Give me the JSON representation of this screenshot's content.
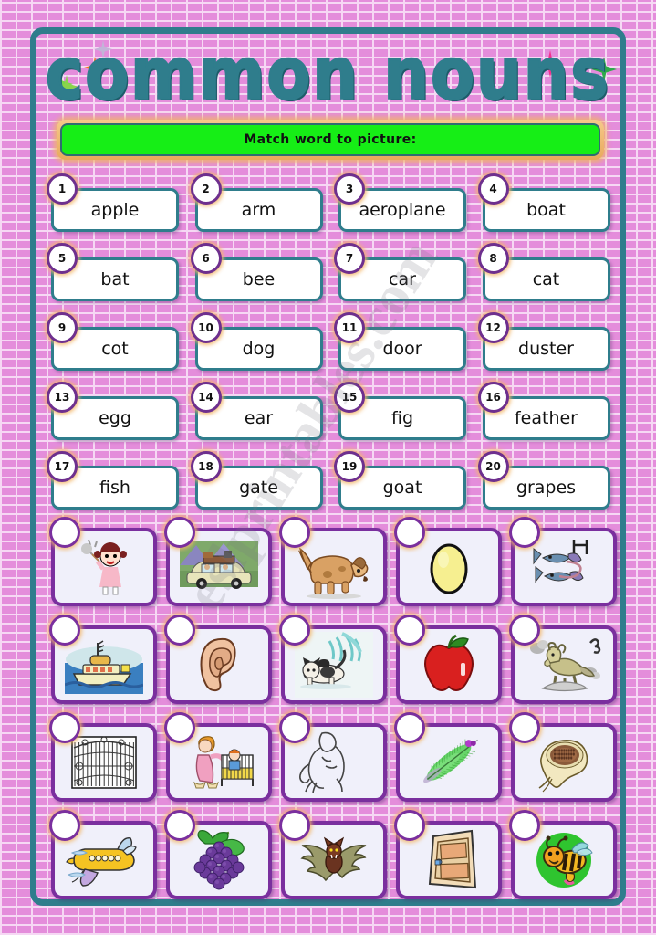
{
  "page": {
    "title": "common nouns",
    "instruction": "Match word to picture:",
    "watermark": "eslprintables.com"
  },
  "colors": {
    "frame_teal": "#2f7d8c",
    "title_teal": "#2f7d8c",
    "instruction_green": "#16ee16",
    "word_border": "#2f7d8c",
    "picture_border": "#7a2f9e",
    "number_ring": "#6e2f8e",
    "background_pink": "#e48ddb",
    "glow_orange": "#f3b668"
  },
  "words": [
    {
      "num": "1",
      "text": "apple"
    },
    {
      "num": "2",
      "text": "arm"
    },
    {
      "num": "3",
      "text": "aeroplane"
    },
    {
      "num": "4",
      "text": "boat"
    },
    {
      "num": "5",
      "text": "bat"
    },
    {
      "num": "6",
      "text": "bee"
    },
    {
      "num": "7",
      "text": "car"
    },
    {
      "num": "8",
      "text": "cat"
    },
    {
      "num": "9",
      "text": "cot"
    },
    {
      "num": "10",
      "text": "dog"
    },
    {
      "num": "11",
      "text": "door"
    },
    {
      "num": "12",
      "text": "duster"
    },
    {
      "num": "13",
      "text": "egg"
    },
    {
      "num": "14",
      "text": "ear"
    },
    {
      "num": "15",
      "text": "fig"
    },
    {
      "num": "16",
      "text": "feather"
    },
    {
      "num": "17",
      "text": "fish"
    },
    {
      "num": "18",
      "text": "gate"
    },
    {
      "num": "19",
      "text": "goat"
    },
    {
      "num": "20",
      "text": "grapes"
    }
  ],
  "pictures": [
    {
      "icon": "duster-girl-icon",
      "answer": ""
    },
    {
      "icon": "car-icon",
      "answer": ""
    },
    {
      "icon": "dog-icon",
      "answer": ""
    },
    {
      "icon": "egg-icon",
      "answer": ""
    },
    {
      "icon": "fish-icon",
      "answer": ""
    },
    {
      "icon": "boat-icon",
      "answer": ""
    },
    {
      "icon": "ear-icon",
      "answer": ""
    },
    {
      "icon": "cat-icon",
      "answer": ""
    },
    {
      "icon": "apple-icon",
      "answer": ""
    },
    {
      "icon": "goat-icon",
      "answer": ""
    },
    {
      "icon": "gate-icon",
      "answer": ""
    },
    {
      "icon": "cot-icon",
      "answer": ""
    },
    {
      "icon": "arm-icon",
      "answer": ""
    },
    {
      "icon": "feather-icon",
      "answer": ""
    },
    {
      "icon": "fig-icon",
      "answer": ""
    },
    {
      "icon": "aeroplane-icon",
      "answer": ""
    },
    {
      "icon": "grapes-icon",
      "answer": ""
    },
    {
      "icon": "bat-icon",
      "answer": ""
    },
    {
      "icon": "door-icon",
      "answer": ""
    },
    {
      "icon": "bee-icon",
      "answer": ""
    }
  ],
  "stars": [
    {
      "name": "star-green-left",
      "color": "#7ad64a"
    },
    {
      "name": "star-orange-left",
      "color": "#f07818"
    },
    {
      "name": "star-lilac-top",
      "color": "#c3b4d8"
    },
    {
      "name": "star-pink-right",
      "color": "#f5318f"
    },
    {
      "name": "star-green-right",
      "color": "#2faa4a"
    },
    {
      "name": "star-orange-mid",
      "color": "#f5a318"
    }
  ]
}
